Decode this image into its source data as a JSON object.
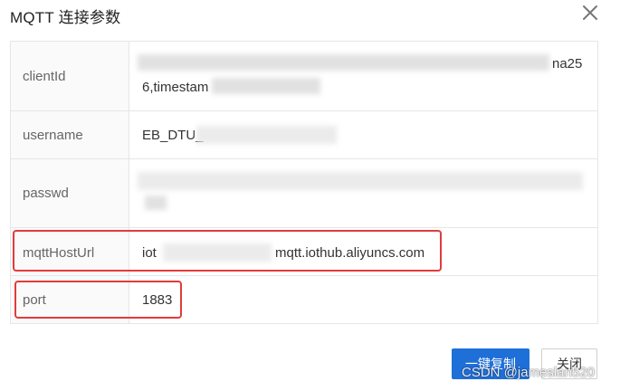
{
  "dialog": {
    "title": "MQTT 连接参数",
    "close_icon": "close-icon"
  },
  "rows": [
    {
      "label": "clientId",
      "value_line1_end": "na25",
      "value_line2": "6,timestam"
    },
    {
      "label": "username",
      "value": "EB_DTU_"
    },
    {
      "label": "passwd",
      "value": ""
    },
    {
      "label": "mqttHostUrl",
      "value_prefix": "iot",
      "value_suffix": "mqtt.iothub.aliyuncs.com"
    },
    {
      "label": "port",
      "value": "1883"
    }
  ],
  "buttons": {
    "copy_all": "一键复制",
    "close": "关闭"
  },
  "watermark": "CSDN @jameslan520",
  "colors": {
    "highlight": "#e23b3b",
    "primary": "#1f6fd8"
  }
}
